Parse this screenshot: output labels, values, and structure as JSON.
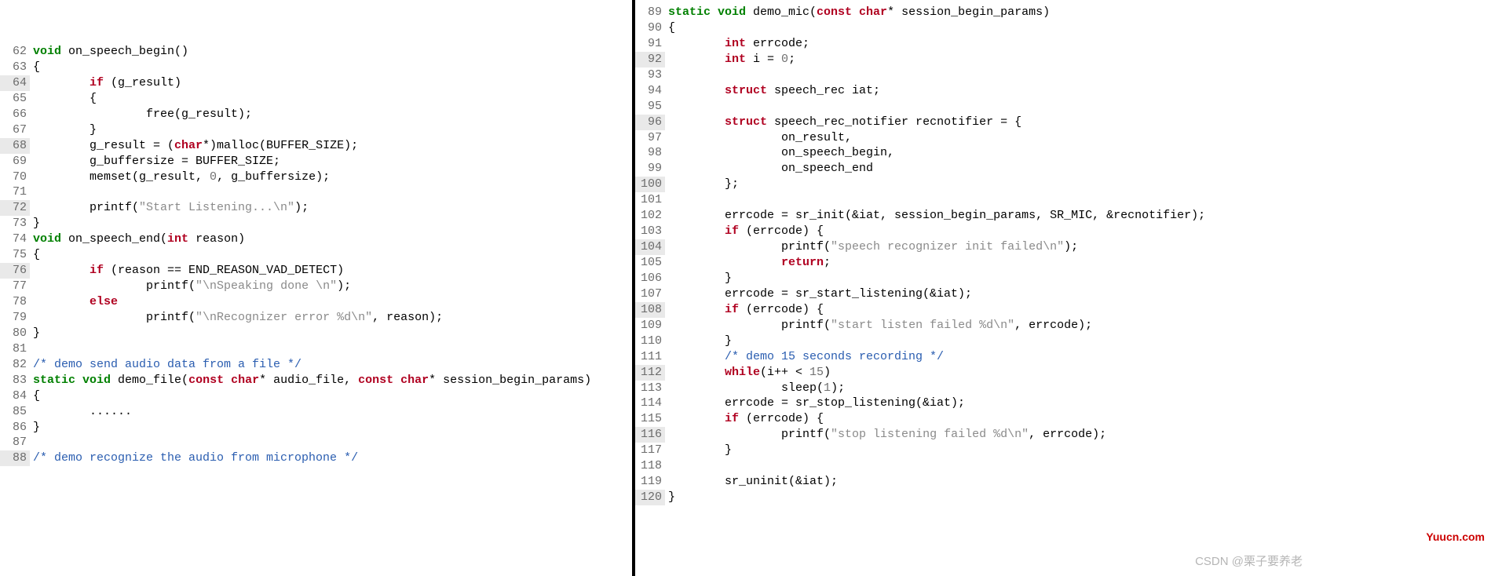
{
  "left": {
    "lines": [
      {
        "n": 62,
        "hl": false,
        "seg": [
          {
            "t": "kwg",
            "v": "void"
          },
          {
            "t": "",
            "v": " on_speech_begin()"
          }
        ]
      },
      {
        "n": 63,
        "hl": false,
        "seg": [
          {
            "t": "",
            "v": "{"
          }
        ]
      },
      {
        "n": 64,
        "hl": true,
        "seg": [
          {
            "t": "",
            "v": "        "
          },
          {
            "t": "kw",
            "v": "if"
          },
          {
            "t": "",
            "v": " (g_result)"
          }
        ]
      },
      {
        "n": 65,
        "hl": false,
        "seg": [
          {
            "t": "",
            "v": "        {"
          }
        ]
      },
      {
        "n": 66,
        "hl": false,
        "seg": [
          {
            "t": "",
            "v": "                free(g_result);"
          }
        ]
      },
      {
        "n": 67,
        "hl": false,
        "seg": [
          {
            "t": "",
            "v": "        }"
          }
        ]
      },
      {
        "n": 68,
        "hl": true,
        "seg": [
          {
            "t": "",
            "v": "        g_result = ("
          },
          {
            "t": "kw",
            "v": "char"
          },
          {
            "t": "",
            "v": "*)malloc(BUFFER_SIZE);"
          }
        ]
      },
      {
        "n": 69,
        "hl": false,
        "seg": [
          {
            "t": "",
            "v": "        g_buffersize = BUFFER_SIZE;"
          }
        ]
      },
      {
        "n": 70,
        "hl": false,
        "seg": [
          {
            "t": "",
            "v": "        memset(g_result, "
          },
          {
            "t": "num",
            "v": "0"
          },
          {
            "t": "",
            "v": ", g_buffersize);"
          }
        ]
      },
      {
        "n": 71,
        "hl": false,
        "seg": [
          {
            "t": "",
            "v": ""
          }
        ]
      },
      {
        "n": 72,
        "hl": true,
        "seg": [
          {
            "t": "",
            "v": "        printf("
          },
          {
            "t": "str",
            "v": "\"Start Listening...\\n\""
          },
          {
            "t": "",
            "v": ");"
          }
        ]
      },
      {
        "n": 73,
        "hl": false,
        "seg": [
          {
            "t": "",
            "v": "}"
          }
        ]
      },
      {
        "n": 74,
        "hl": false,
        "seg": [
          {
            "t": "kwg",
            "v": "void"
          },
          {
            "t": "",
            "v": " on_speech_end("
          },
          {
            "t": "kw",
            "v": "int"
          },
          {
            "t": "",
            "v": " reason)"
          }
        ]
      },
      {
        "n": 75,
        "hl": false,
        "seg": [
          {
            "t": "",
            "v": "{"
          }
        ]
      },
      {
        "n": 76,
        "hl": true,
        "seg": [
          {
            "t": "",
            "v": "        "
          },
          {
            "t": "kw",
            "v": "if"
          },
          {
            "t": "",
            "v": " (reason == END_REASON_VAD_DETECT)"
          }
        ]
      },
      {
        "n": 77,
        "hl": false,
        "seg": [
          {
            "t": "",
            "v": "                printf("
          },
          {
            "t": "str",
            "v": "\"\\nSpeaking done \\n\""
          },
          {
            "t": "",
            "v": ");"
          }
        ]
      },
      {
        "n": 78,
        "hl": false,
        "seg": [
          {
            "t": "",
            "v": "        "
          },
          {
            "t": "kw",
            "v": "else"
          }
        ]
      },
      {
        "n": 79,
        "hl": false,
        "seg": [
          {
            "t": "",
            "v": "                printf("
          },
          {
            "t": "str",
            "v": "\"\\nRecognizer error %d\\n\""
          },
          {
            "t": "",
            "v": ", reason);"
          }
        ]
      },
      {
        "n": 80,
        "hl": false,
        "seg": [
          {
            "t": "",
            "v": "}"
          }
        ]
      },
      {
        "n": 81,
        "hl": false,
        "seg": [
          {
            "t": "",
            "v": ""
          }
        ]
      },
      {
        "n": 82,
        "hl": false,
        "seg": [
          {
            "t": "cmt",
            "v": "/* demo send audio data from a file */"
          }
        ]
      },
      {
        "n": 83,
        "hl": false,
        "seg": [
          {
            "t": "kwg",
            "v": "static void"
          },
          {
            "t": "",
            "v": " demo_file("
          },
          {
            "t": "kw",
            "v": "const char"
          },
          {
            "t": "",
            "v": "* audio_file, "
          },
          {
            "t": "kw",
            "v": "const char"
          },
          {
            "t": "",
            "v": "* session_begin_params)"
          }
        ]
      },
      {
        "n": 84,
        "hl": false,
        "seg": [
          {
            "t": "",
            "v": "{"
          }
        ]
      },
      {
        "n": 85,
        "hl": false,
        "seg": [
          {
            "t": "",
            "v": "        ......"
          }
        ]
      },
      {
        "n": 86,
        "hl": false,
        "seg": [
          {
            "t": "",
            "v": "}"
          }
        ]
      },
      {
        "n": 87,
        "hl": false,
        "seg": [
          {
            "t": "",
            "v": ""
          }
        ]
      },
      {
        "n": 88,
        "hl": true,
        "seg": [
          {
            "t": "cmt",
            "v": "/* demo recognize the audio from microphone */"
          }
        ]
      }
    ]
  },
  "right": {
    "lines": [
      {
        "n": 89,
        "hl": false,
        "seg": [
          {
            "t": "kwg",
            "v": "static void"
          },
          {
            "t": "",
            "v": " demo_mic("
          },
          {
            "t": "kw",
            "v": "const char"
          },
          {
            "t": "",
            "v": "* session_begin_params)"
          }
        ]
      },
      {
        "n": 90,
        "hl": false,
        "seg": [
          {
            "t": "",
            "v": "{"
          }
        ]
      },
      {
        "n": 91,
        "hl": false,
        "seg": [
          {
            "t": "",
            "v": "        "
          },
          {
            "t": "kw",
            "v": "int"
          },
          {
            "t": "",
            "v": " errcode;"
          }
        ]
      },
      {
        "n": 92,
        "hl": true,
        "seg": [
          {
            "t": "",
            "v": "        "
          },
          {
            "t": "kw",
            "v": "int"
          },
          {
            "t": "",
            "v": " i = "
          },
          {
            "t": "num",
            "v": "0"
          },
          {
            "t": "",
            "v": ";"
          }
        ]
      },
      {
        "n": 93,
        "hl": false,
        "seg": [
          {
            "t": "",
            "v": ""
          }
        ]
      },
      {
        "n": 94,
        "hl": false,
        "seg": [
          {
            "t": "",
            "v": "        "
          },
          {
            "t": "kw",
            "v": "struct"
          },
          {
            "t": "",
            "v": " speech_rec iat;"
          }
        ]
      },
      {
        "n": 95,
        "hl": false,
        "seg": [
          {
            "t": "",
            "v": ""
          }
        ]
      },
      {
        "n": 96,
        "hl": true,
        "seg": [
          {
            "t": "",
            "v": "        "
          },
          {
            "t": "kw",
            "v": "struct"
          },
          {
            "t": "",
            "v": " speech_rec_notifier recnotifier = {"
          }
        ]
      },
      {
        "n": 97,
        "hl": false,
        "seg": [
          {
            "t": "",
            "v": "                on_result,"
          }
        ]
      },
      {
        "n": 98,
        "hl": false,
        "seg": [
          {
            "t": "",
            "v": "                on_speech_begin,"
          }
        ]
      },
      {
        "n": 99,
        "hl": false,
        "seg": [
          {
            "t": "",
            "v": "                on_speech_end"
          }
        ]
      },
      {
        "n": 100,
        "hl": true,
        "seg": [
          {
            "t": "",
            "v": "        };"
          }
        ]
      },
      {
        "n": 101,
        "hl": false,
        "seg": [
          {
            "t": "",
            "v": ""
          }
        ]
      },
      {
        "n": 102,
        "hl": false,
        "seg": [
          {
            "t": "",
            "v": "        errcode = sr_init(&iat, session_begin_params, SR_MIC, &recnotifier);"
          }
        ]
      },
      {
        "n": 103,
        "hl": false,
        "seg": [
          {
            "t": "",
            "v": "        "
          },
          {
            "t": "kw",
            "v": "if"
          },
          {
            "t": "",
            "v": " (errcode) {"
          }
        ]
      },
      {
        "n": 104,
        "hl": true,
        "seg": [
          {
            "t": "",
            "v": "                printf("
          },
          {
            "t": "str",
            "v": "\"speech recognizer init failed\\n\""
          },
          {
            "t": "",
            "v": ");"
          }
        ]
      },
      {
        "n": 105,
        "hl": false,
        "seg": [
          {
            "t": "",
            "v": "                "
          },
          {
            "t": "kw",
            "v": "return"
          },
          {
            "t": "",
            "v": ";"
          }
        ]
      },
      {
        "n": 106,
        "hl": false,
        "seg": [
          {
            "t": "",
            "v": "        }"
          }
        ]
      },
      {
        "n": 107,
        "hl": false,
        "seg": [
          {
            "t": "",
            "v": "        errcode = sr_start_listening(&iat);"
          }
        ]
      },
      {
        "n": 108,
        "hl": true,
        "seg": [
          {
            "t": "",
            "v": "        "
          },
          {
            "t": "kw",
            "v": "if"
          },
          {
            "t": "",
            "v": " (errcode) {"
          }
        ]
      },
      {
        "n": 109,
        "hl": false,
        "seg": [
          {
            "t": "",
            "v": "                printf("
          },
          {
            "t": "str",
            "v": "\"start listen failed %d\\n\""
          },
          {
            "t": "",
            "v": ", errcode);"
          }
        ]
      },
      {
        "n": 110,
        "hl": false,
        "seg": [
          {
            "t": "",
            "v": "        }"
          }
        ]
      },
      {
        "n": 111,
        "hl": false,
        "seg": [
          {
            "t": "",
            "v": "        "
          },
          {
            "t": "cmt",
            "v": "/* demo 15 seconds recording */"
          }
        ]
      },
      {
        "n": 112,
        "hl": true,
        "seg": [
          {
            "t": "",
            "v": "        "
          },
          {
            "t": "kw",
            "v": "while"
          },
          {
            "t": "",
            "v": "(i++ < "
          },
          {
            "t": "num",
            "v": "15"
          },
          {
            "t": "",
            "v": ")"
          }
        ]
      },
      {
        "n": 113,
        "hl": false,
        "seg": [
          {
            "t": "",
            "v": "                sleep("
          },
          {
            "t": "num",
            "v": "1"
          },
          {
            "t": "",
            "v": ");"
          }
        ]
      },
      {
        "n": 114,
        "hl": false,
        "seg": [
          {
            "t": "",
            "v": "        errcode = sr_stop_listening(&iat);"
          }
        ]
      },
      {
        "n": 115,
        "hl": false,
        "seg": [
          {
            "t": "",
            "v": "        "
          },
          {
            "t": "kw",
            "v": "if"
          },
          {
            "t": "",
            "v": " (errcode) {"
          }
        ]
      },
      {
        "n": 116,
        "hl": true,
        "seg": [
          {
            "t": "",
            "v": "                printf("
          },
          {
            "t": "str",
            "v": "\"stop listening failed %d\\n\""
          },
          {
            "t": "",
            "v": ", errcode);"
          }
        ]
      },
      {
        "n": 117,
        "hl": false,
        "seg": [
          {
            "t": "",
            "v": "        }"
          }
        ]
      },
      {
        "n": 118,
        "hl": false,
        "seg": [
          {
            "t": "",
            "v": ""
          }
        ]
      },
      {
        "n": 119,
        "hl": false,
        "seg": [
          {
            "t": "",
            "v": "        sr_uninit(&iat);"
          }
        ]
      },
      {
        "n": 120,
        "hl": true,
        "seg": [
          {
            "t": "",
            "v": "}"
          }
        ]
      }
    ]
  },
  "watermarks": {
    "yuucn": "Yuucn.com",
    "csdn": "CSDN @栗子要养老"
  }
}
